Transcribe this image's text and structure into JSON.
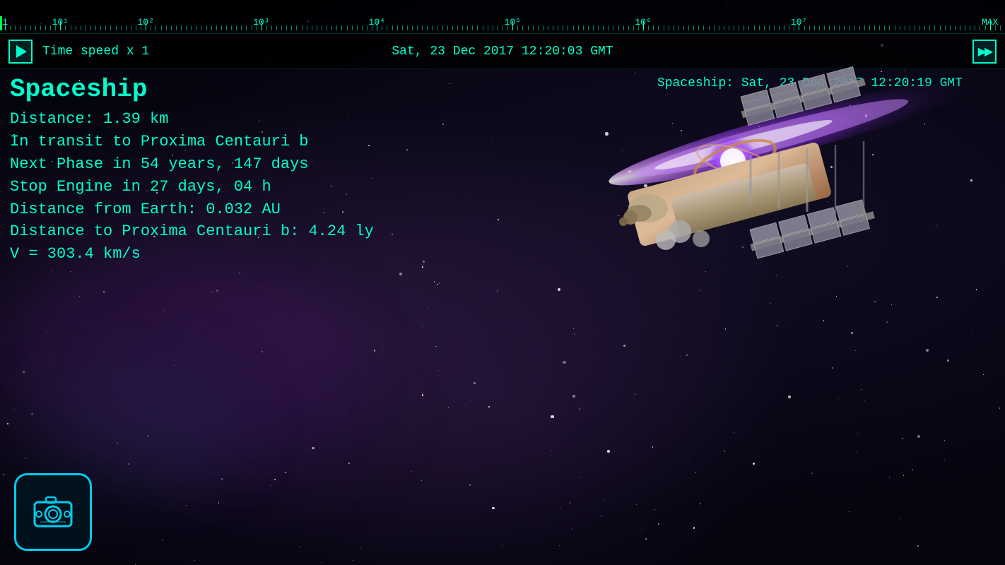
{
  "ruler": {
    "labels": [
      "1",
      "10¹",
      "10²",
      "10³",
      "10⁴",
      "10⁵",
      "10⁶",
      "10⁷",
      "MAX"
    ],
    "positions": [
      0.005,
      0.06,
      0.145,
      0.26,
      0.375,
      0.51,
      0.64,
      0.795,
      0.985
    ]
  },
  "controls": {
    "play_label": "▶",
    "time_speed": "Time speed x 1",
    "datetime": "Sat, 23 Dec 2017  12:20:03 GMT",
    "ff_label": "▶▶"
  },
  "spaceship": {
    "title": "Spaceship",
    "spaceship_datetime": "Spaceship:  Sat, 23 Dec 2017  12:20:19 GMT",
    "distance": "Distance: 1.39 km",
    "transit": "In transit to Proxima Centauri b",
    "next_phase": "Next Phase in 54 years, 147 days",
    "stop_engine": "Stop Engine in 27 days, 04 h",
    "distance_earth": "Distance from Earth: 0.032 AU",
    "distance_proxima": "Distance to Proxima Centauri b: 4.24 ly",
    "velocity": "V = 303.4 km/s"
  },
  "ui": {
    "camera_button_label": "camera",
    "accent_color": "#00ffcc",
    "bg_color": "#050510"
  }
}
